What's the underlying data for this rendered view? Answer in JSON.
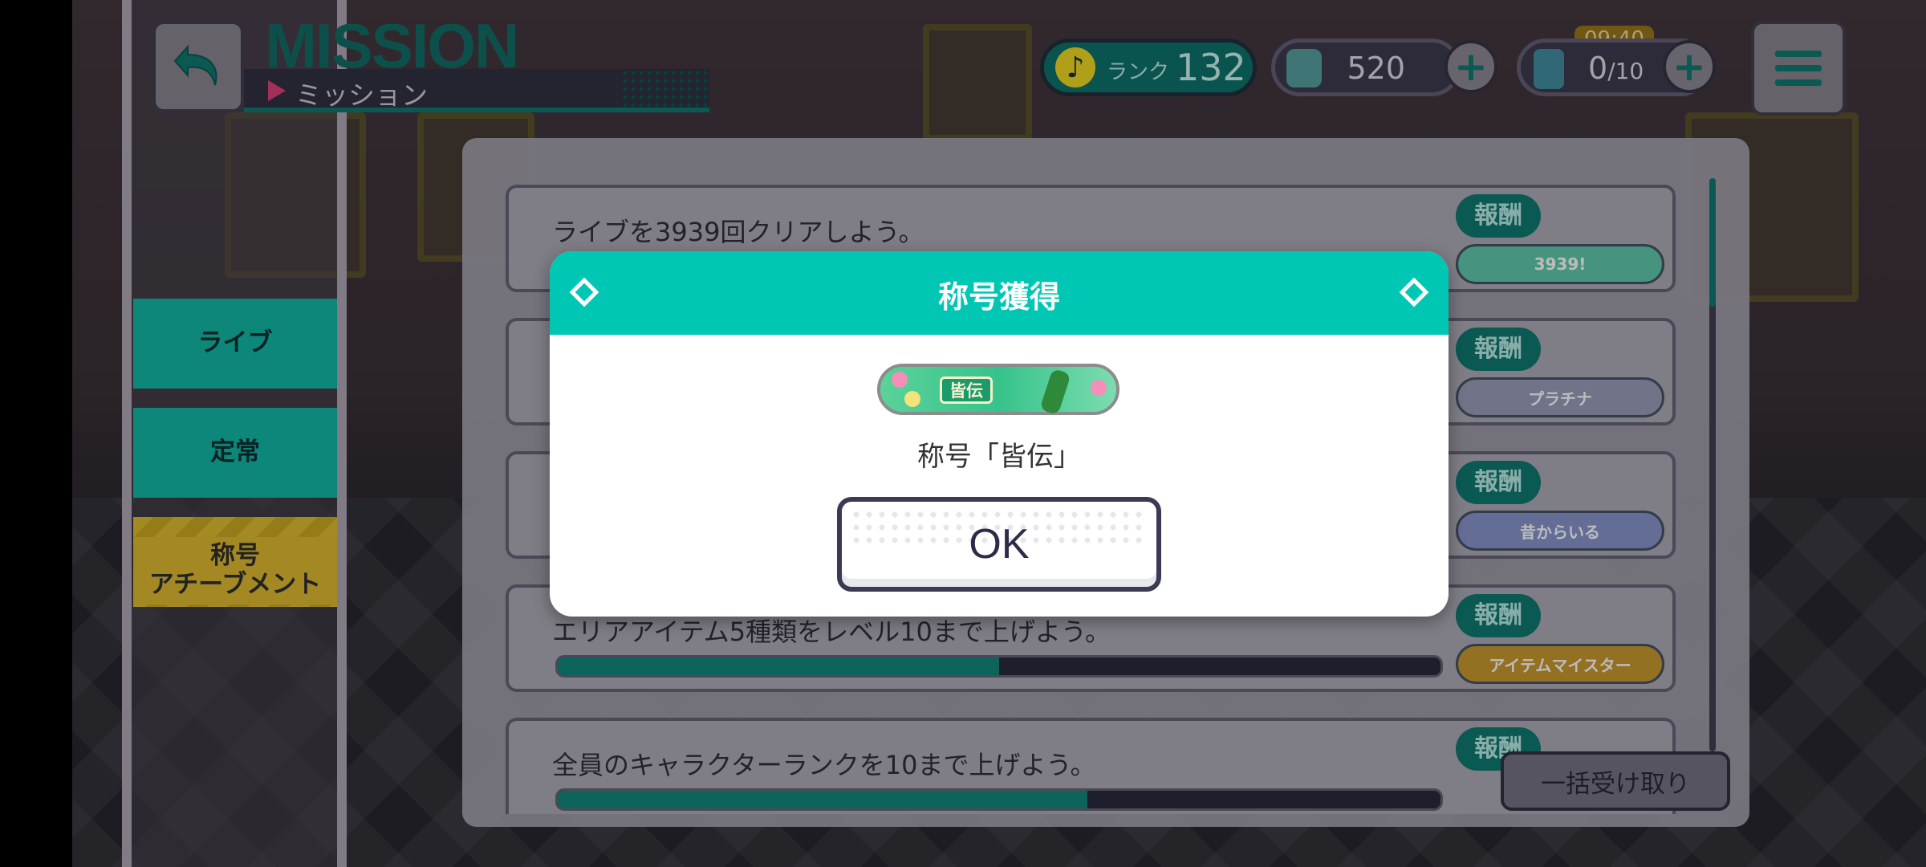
{
  "header": {
    "title": "MISSION",
    "subtitle": "ミッション",
    "rank_label": "ランク",
    "rank_value": "132",
    "gems": "520",
    "energy_current": "0",
    "energy_max": "/10",
    "energy_timer": "09:40"
  },
  "sidebar": {
    "items": [
      {
        "label": "ライブ"
      },
      {
        "label": "定常"
      },
      {
        "label": "称号\nアチーブメント"
      }
    ]
  },
  "missions": [
    {
      "text": "ライブを3939回クリアしよう。",
      "reward_tag": "報酬",
      "reward_plate": "3939!",
      "progress": null
    },
    {
      "text": "",
      "reward_tag": "報酬",
      "reward_plate": "プラチナ",
      "progress": null
    },
    {
      "text": "",
      "reward_tag": "報酬",
      "reward_plate": "昔からいる",
      "progress": null
    },
    {
      "text": "エリアアイテム5種類をレベル10まで上げよう。",
      "reward_tag": "報酬",
      "reward_plate": "アイテムマイスター",
      "progress": 0.5
    },
    {
      "text": "全員のキャラクターランクを10まで上げよう。",
      "reward_tag": "報酬",
      "reward_plate": "",
      "progress": 0.6
    }
  ],
  "bulk_button": "一括受け取り",
  "modal": {
    "title": "称号獲得",
    "badge_text": "皆伝",
    "award_text": "称号「皆伝」",
    "ok": "OK"
  },
  "colors": {
    "accent": "#00c7b4",
    "teal_dark": "#0d6d66"
  }
}
